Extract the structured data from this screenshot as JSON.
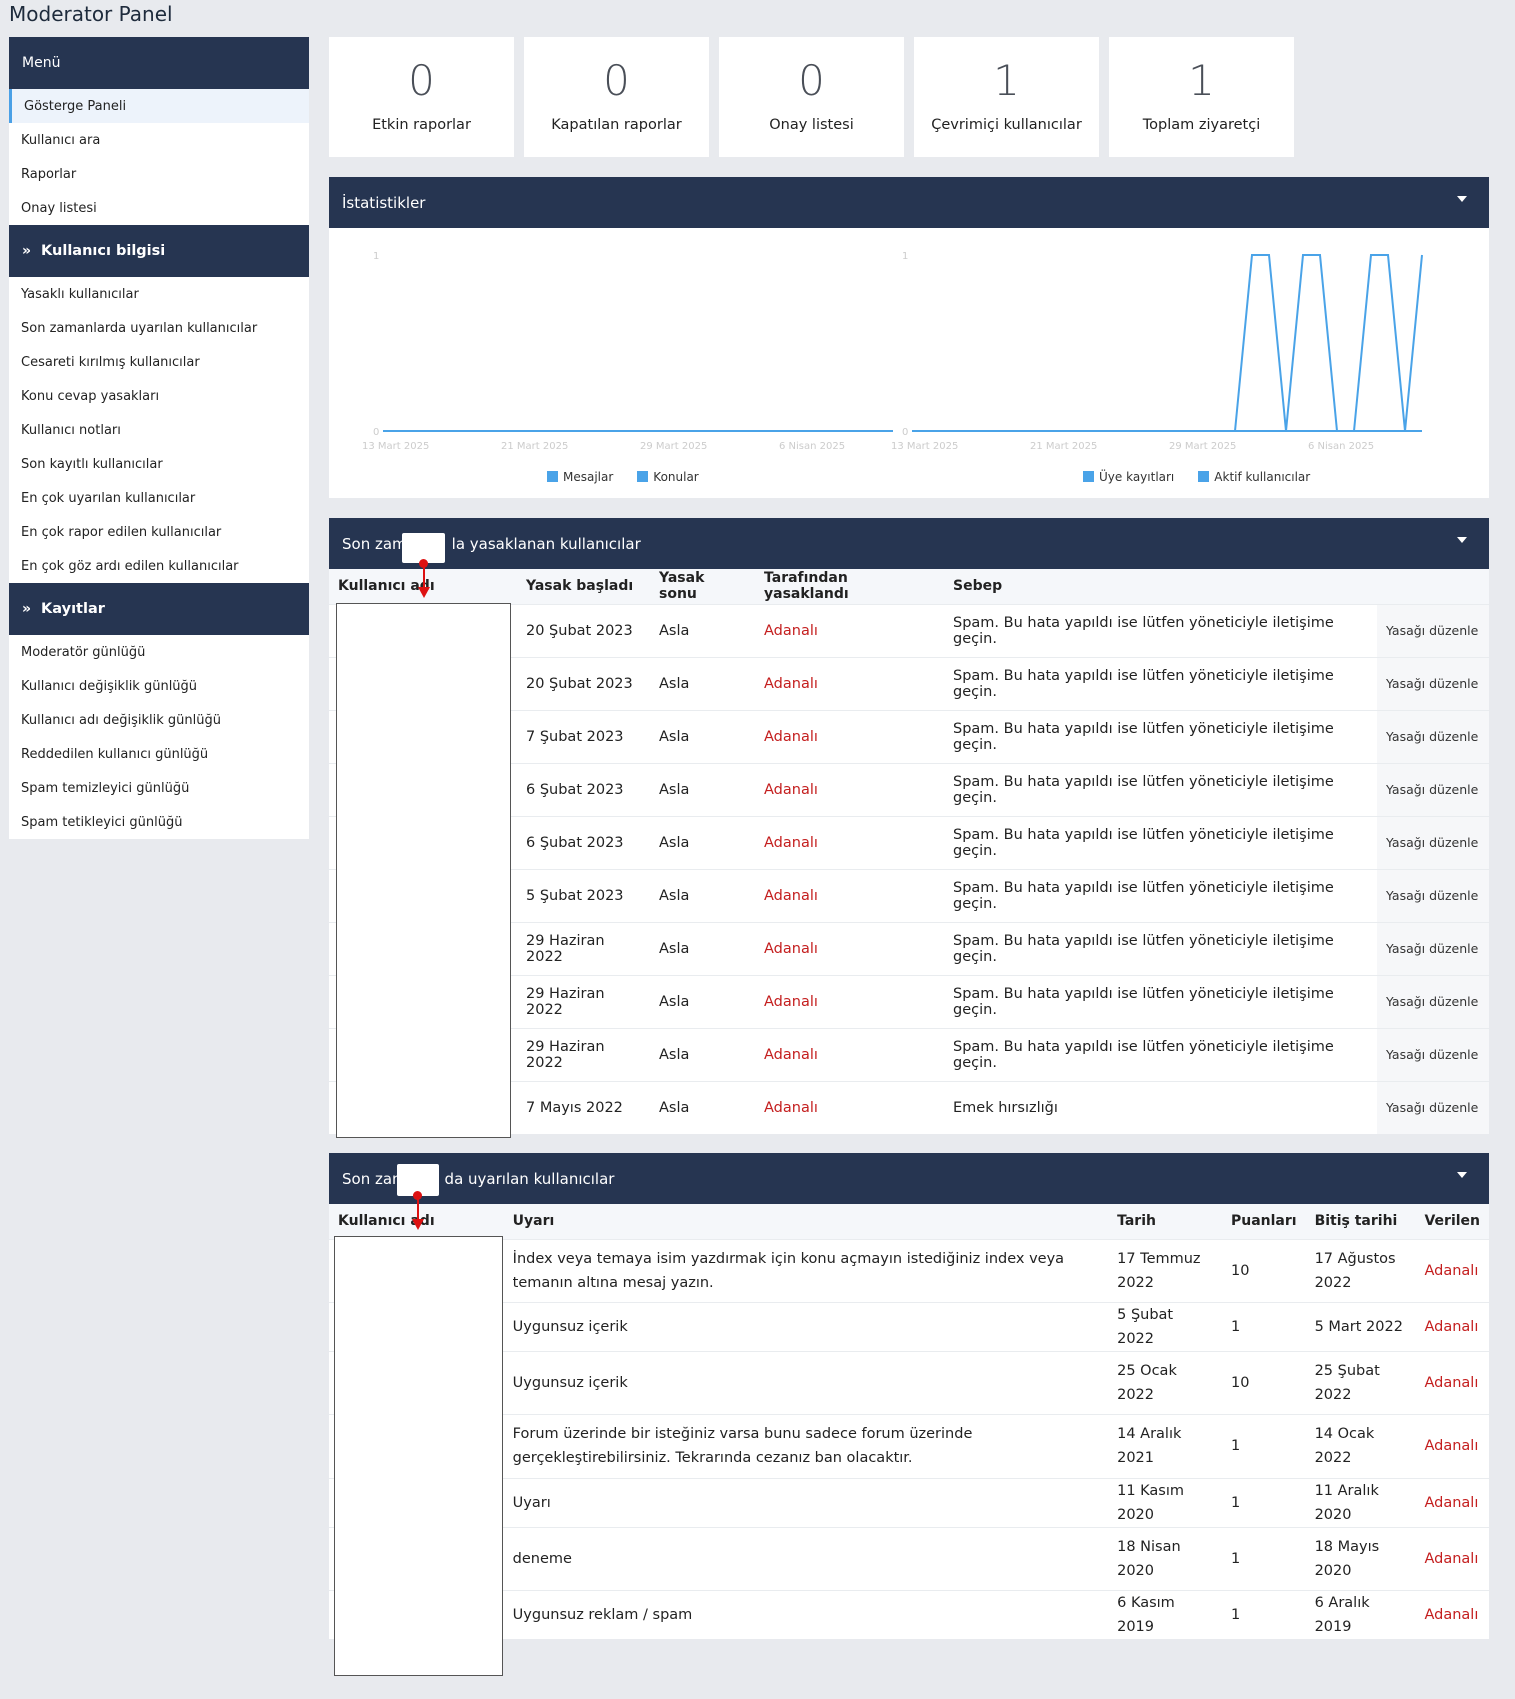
{
  "page": {
    "title": "Moderator Panel"
  },
  "sidebar": {
    "menu_title": "Menü",
    "menu_items": [
      "Gösterge Paneli",
      "Kullanıcı ara",
      "Raporlar",
      "Onay listesi"
    ],
    "user_info_title": "Kullanıcı bilgisi",
    "user_info_items": [
      "Yasaklı kullanıcılar",
      "Son zamanlarda uyarılan kullanıcılar",
      "Cesareti kırılmış kullanıcılar",
      "Konu cevap yasakları",
      "Kullanıcı notları",
      "Son kayıtlı kullanıcılar",
      "En çok uyarılan kullanıcılar",
      "En çok rapor edilen kullanıcılar",
      "En çok göz ardı edilen kullanıcılar"
    ],
    "logs_title": "Kayıtlar",
    "logs_items": [
      "Moderatör günlüğü",
      "Kullanıcı değişiklik günlüğü",
      "Kullanıcı adı değişiklik günlüğü",
      "Reddedilen kullanıcı günlüğü",
      "Spam temizleyici günlüğü",
      "Spam tetikleyici günlüğü"
    ]
  },
  "stat_cards": [
    {
      "value": "0",
      "label": "Etkin raporlar"
    },
    {
      "value": "0",
      "label": "Kapatılan raporlar"
    },
    {
      "value": "0",
      "label": "Onay listesi"
    },
    {
      "value": "1",
      "label": "Çevrimiçi kullanıcılar"
    },
    {
      "value": "1",
      "label": "Toplam ziyaretçi"
    }
  ],
  "stats_panel": {
    "title": "İstatistikler"
  },
  "chart_data": [
    {
      "type": "line",
      "x_ticks": [
        "13 Mart 2025",
        "21 Mart 2025",
        "29 Mart 2025",
        "6 Nisan 2025"
      ],
      "y_ticks": [
        "0",
        "1"
      ],
      "ylim": [
        0,
        1
      ],
      "legend_position": "bottom",
      "series": [
        {
          "name": "Mesajlar",
          "values": [
            0,
            0,
            0,
            0,
            0,
            0,
            0,
            0,
            0,
            0,
            0,
            0,
            0,
            0,
            0,
            0,
            0,
            0,
            0,
            0,
            0,
            0,
            0,
            0,
            0,
            0,
            0,
            0,
            0,
            0
          ]
        },
        {
          "name": "Konular",
          "values": [
            0,
            0,
            0,
            0,
            0,
            0,
            0,
            0,
            0,
            0,
            0,
            0,
            0,
            0,
            0,
            0,
            0,
            0,
            0,
            0,
            0,
            0,
            0,
            0,
            0,
            0,
            0,
            0,
            0,
            0
          ]
        }
      ],
      "color": "#4aa3e8"
    },
    {
      "type": "line",
      "x_ticks": [
        "13 Mart 2025",
        "21 Mart 2025",
        "29 Mart 2025",
        "6 Nisan 2025"
      ],
      "y_ticks": [
        "0",
        "1"
      ],
      "ylim": [
        0,
        1
      ],
      "legend_position": "bottom",
      "series": [
        {
          "name": "Üye kayıtları",
          "values": [
            0,
            0,
            0,
            0,
            0,
            0,
            0,
            0,
            0,
            0,
            0,
            0,
            0,
            0,
            0,
            0,
            0,
            0,
            0,
            0,
            0,
            0,
            0,
            0,
            0,
            0,
            0,
            0,
            0,
            0
          ]
        },
        {
          "name": "Aktif kullanıcılar",
          "values": [
            0,
            0,
            0,
            0,
            0,
            0,
            0,
            0,
            0,
            0,
            0,
            0,
            0,
            0,
            0,
            0,
            0,
            0,
            0,
            0,
            1,
            1,
            0,
            1,
            1,
            0,
            0,
            1,
            1,
            0,
            1
          ]
        }
      ],
      "color": "#4aa3e8"
    }
  ],
  "bans_panel": {
    "title_start": "Son zam",
    "title_end": "la yasaklanan kullanıcılar",
    "columns": [
      "Kullanıcı adı",
      "Yasak başladı",
      "Yasak sonu",
      "Tarafından yasaklandı",
      "Sebep"
    ],
    "action_label": "Yasağı düzenle",
    "rows": [
      {
        "start": "20 Şubat 2023",
        "end": "Asla",
        "by": "Adanalı",
        "reason": "Spam. Bu hata yapıldı ise lütfen yöneticiyle iletişime geçin."
      },
      {
        "start": "20 Şubat 2023",
        "end": "Asla",
        "by": "Adanalı",
        "reason": "Spam. Bu hata yapıldı ise lütfen yöneticiyle iletişime geçin."
      },
      {
        "start": "7 Şubat 2023",
        "end": "Asla",
        "by": "Adanalı",
        "reason": "Spam. Bu hata yapıldı ise lütfen yöneticiyle iletişime geçin."
      },
      {
        "start": "6 Şubat 2023",
        "end": "Asla",
        "by": "Adanalı",
        "reason": "Spam. Bu hata yapıldı ise lütfen yöneticiyle iletişime geçin."
      },
      {
        "start": "6 Şubat 2023",
        "end": "Asla",
        "by": "Adanalı",
        "reason": "Spam. Bu hata yapıldı ise lütfen yöneticiyle iletişime geçin."
      },
      {
        "start": "5 Şubat 2023",
        "end": "Asla",
        "by": "Adanalı",
        "reason": "Spam. Bu hata yapıldı ise lütfen yöneticiyle iletişime geçin."
      },
      {
        "start": "29 Haziran 2022",
        "end": "Asla",
        "by": "Adanalı",
        "reason": "Spam. Bu hata yapıldı ise lütfen yöneticiyle iletişime geçin."
      },
      {
        "start": "29 Haziran 2022",
        "end": "Asla",
        "by": "Adanalı",
        "reason": "Spam. Bu hata yapıldı ise lütfen yöneticiyle iletişime geçin."
      },
      {
        "start": "29 Haziran 2022",
        "end": "Asla",
        "by": "Adanalı",
        "reason": "Spam. Bu hata yapıldı ise lütfen yöneticiyle iletişime geçin."
      },
      {
        "start": "7 Mayıs 2022",
        "end": "Asla",
        "by": "Adanalı",
        "reason": "Emek hırsızlığı"
      }
    ]
  },
  "warnings_panel": {
    "title_start": "Son zan",
    "title_end": "da uyarılan kullanıcılar",
    "columns": [
      "Kullanıcı adı",
      "Uyarı",
      "Tarih",
      "Puanları",
      "Bitiş tarihi",
      "Verilen"
    ],
    "rows": [
      {
        "warning": "İndex veya temaya isim yazdırmak için konu açmayın istediğiniz index veya temanın altına mesaj yazın.",
        "date": "17 Temmuz 2022",
        "points": "10",
        "expiry": "17 Ağustos 2022",
        "by": "Adanalı"
      },
      {
        "warning": "Uygunsuz içerik",
        "date": "5 Şubat 2022",
        "points": "1",
        "expiry": "5 Mart 2022",
        "by": "Adanalı"
      },
      {
        "warning": "Uygunsuz içerik",
        "date": "25 Ocak 2022",
        "points": "10",
        "expiry": "25 Şubat 2022",
        "by": "Adanalı"
      },
      {
        "warning": "Forum üzerinde bir isteğiniz varsa bunu sadece forum üzerinde gerçekleştirebilirsiniz. Tekrarında cezanız ban olacaktır.",
        "date": "14 Aralık 2021",
        "points": "1",
        "expiry": "14 Ocak 2022",
        "by": "Adanalı"
      },
      {
        "warning": "Uyarı",
        "date": "11 Kasım 2020",
        "points": "1",
        "expiry": "11 Aralık 2020",
        "by": "Adanalı"
      },
      {
        "warning": "deneme",
        "date": "18 Nisan 2020",
        "points": "1",
        "expiry": "18 Mayıs 2020",
        "by": "Adanalı"
      },
      {
        "warning": "Uygunsuz reklam / spam",
        "date": "6 Kasım 2019",
        "points": "1",
        "expiry": "6 Aralık 2019",
        "by": "Adanalı"
      }
    ]
  }
}
